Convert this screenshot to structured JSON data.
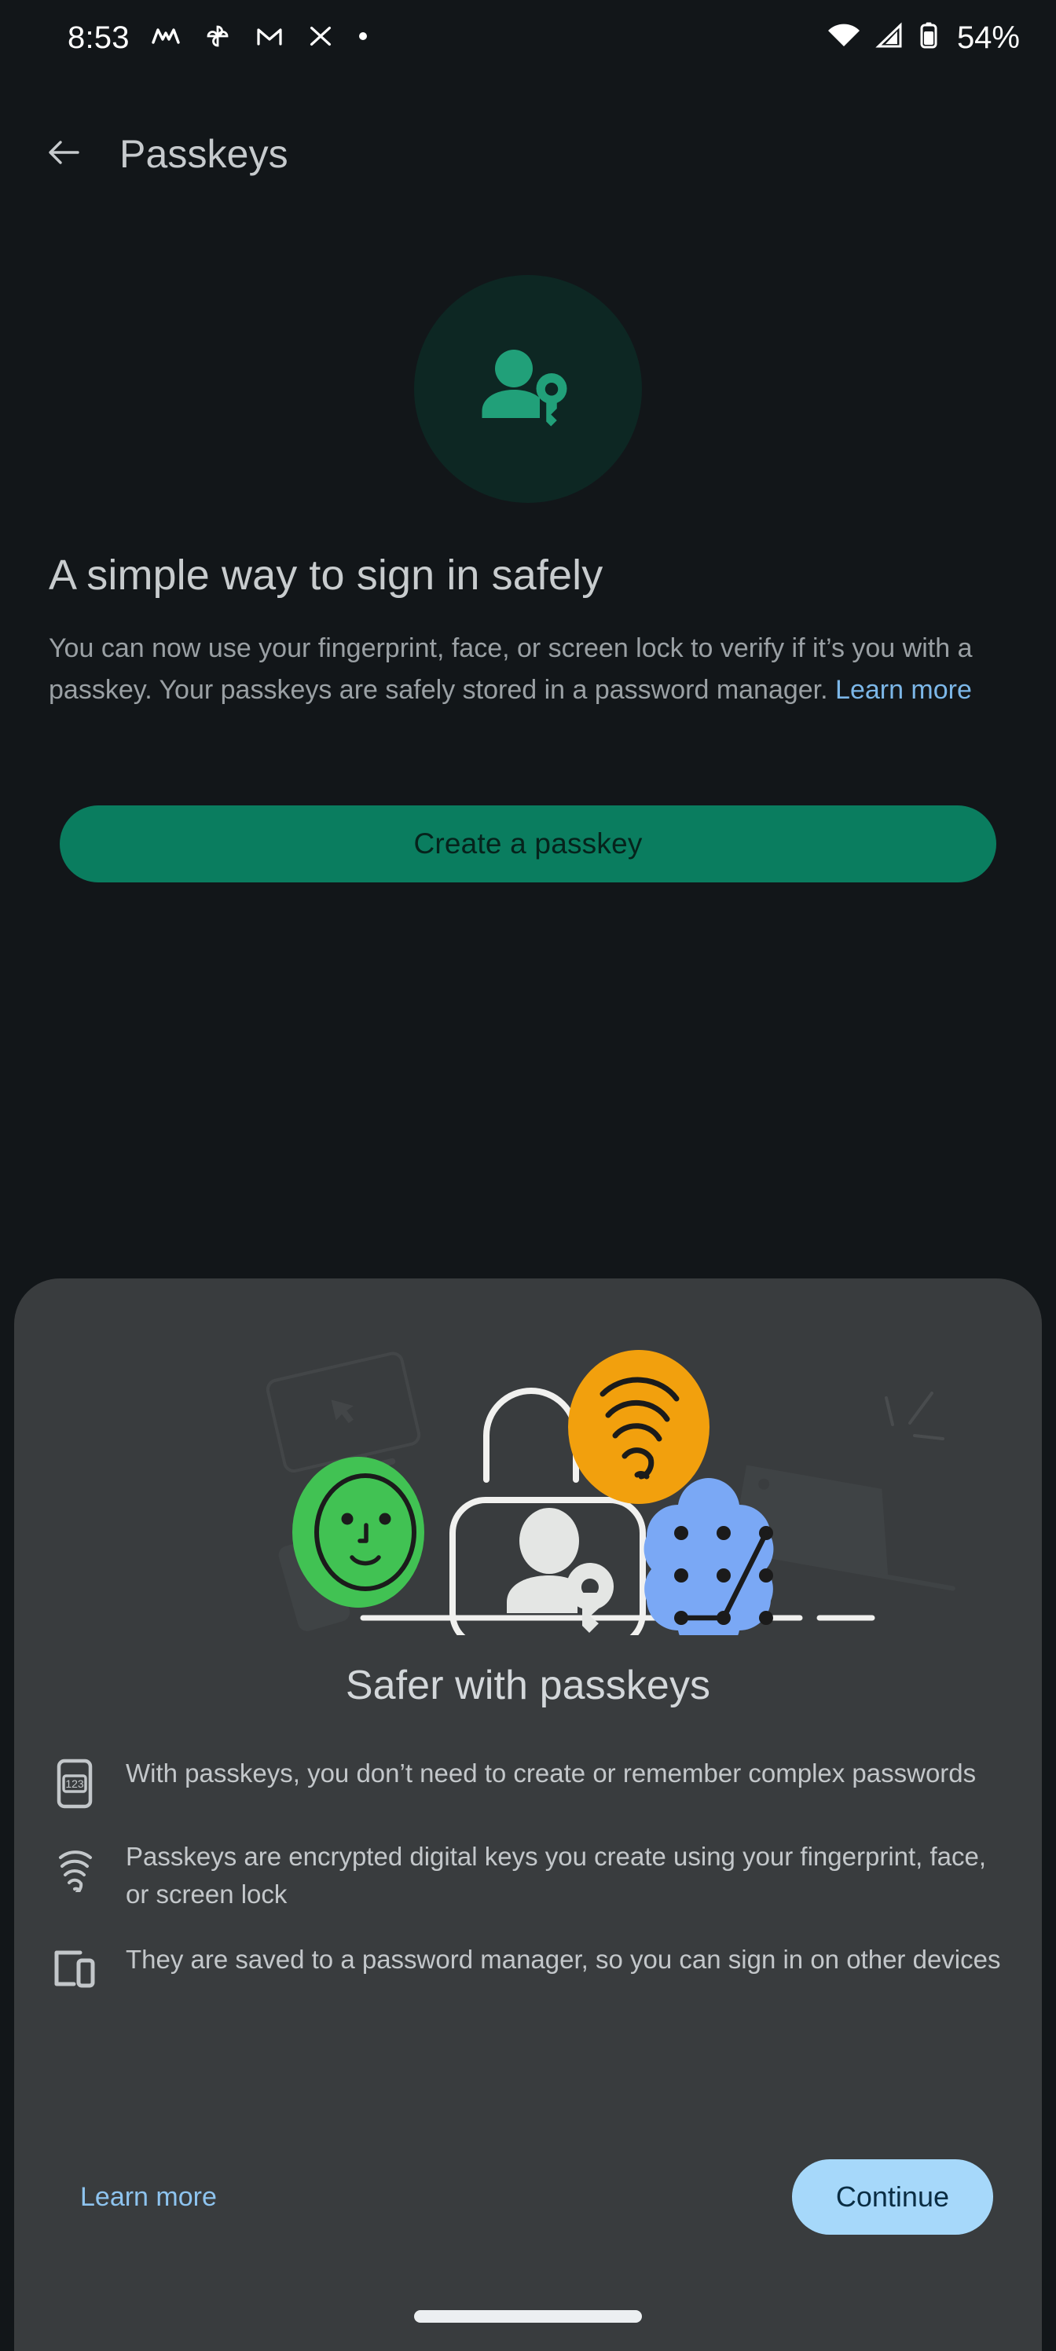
{
  "status_bar": {
    "time": "8:53",
    "battery_percent": "54%",
    "left_icons": [
      "monzo-icon",
      "google-photos-icon",
      "gmail-icon",
      "x-icon",
      "more-notifications-dot-icon"
    ],
    "right_icons": [
      "wifi-icon",
      "cellular-signal-icon",
      "battery-icon"
    ]
  },
  "app_bar": {
    "back_icon": "back-arrow-icon",
    "title": "Passkeys"
  },
  "hero": {
    "icon": "person-key-icon",
    "title": "A simple way to sign in safely",
    "description": "You can now use your fingerprint, face, or screen lock to verify if it’s you with a passkey. Your passkeys are safely stored in a password manager.",
    "learn_more_label": "Learn more",
    "cta_label": "Create a passkey"
  },
  "sheet": {
    "illustration": "passkey-lock-illustration",
    "title": "Safer with passkeys",
    "features": [
      {
        "icon": "password-123-icon",
        "text": "With passkeys, you don’t need to create or remember complex passwords"
      },
      {
        "icon": "fingerprint-icon",
        "text": "Passkeys are encrypted digital keys you create using your fingerprint, face, or screen lock"
      },
      {
        "icon": "devices-icon",
        "text": "They are saved to a password manager, so you can sign in on other devices"
      }
    ],
    "learn_more_label": "Learn more",
    "continue_label": "Continue"
  },
  "colors": {
    "page_background": "#121619",
    "sheet_background": "#393c3e",
    "hero_circle_background": "#0d2723",
    "accent_green": "#0a7d5f",
    "hero_icon_green": "#1f9c75",
    "link_blue": "#7cb7e8",
    "continue_button": "#a6d8fa",
    "illustration_orange": "#f2a00d",
    "illustration_green": "#41c253",
    "illustration_blue": "#7aa8f5",
    "illustration_white": "#e4e6e4"
  },
  "nav": {
    "gesture_pill": "home-gesture-pill"
  }
}
